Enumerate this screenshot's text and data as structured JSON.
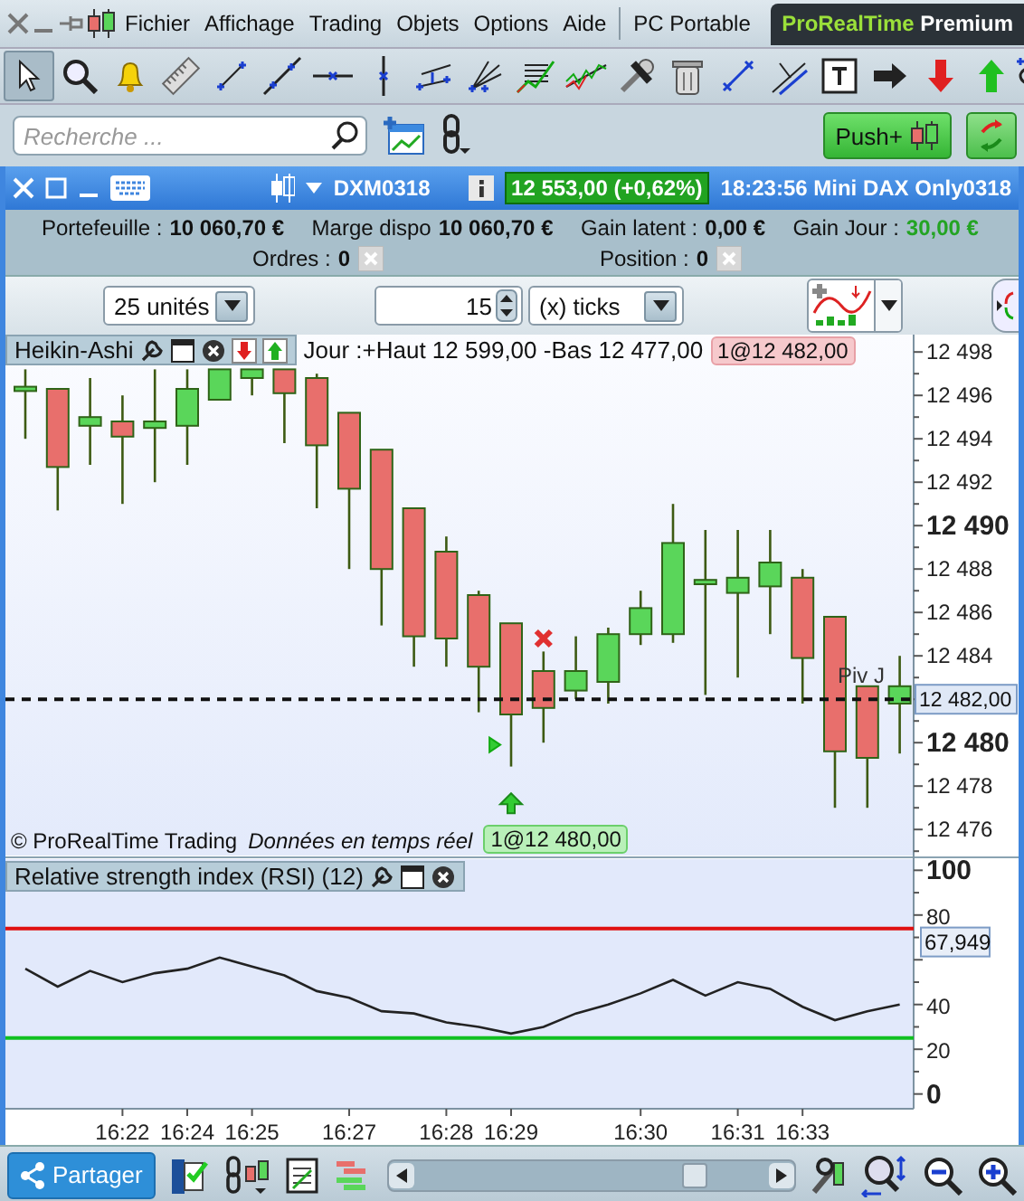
{
  "menubar": {
    "items": [
      {
        "label": "Fichier"
      },
      {
        "label": "Affichage"
      },
      {
        "label": "Trading"
      },
      {
        "label": "Objets"
      },
      {
        "label": "Options"
      },
      {
        "label": "Aide"
      }
    ],
    "workspace": "PC Portable",
    "brand": {
      "name": "ProRealTime",
      "edition": "Premium"
    }
  },
  "toolbar": {
    "tools": [
      {
        "selected": true
      },
      {
        "selected": false
      },
      {
        "selected": false
      },
      {
        "selected": false
      },
      {
        "selected": false
      },
      {
        "selected": false
      },
      {
        "selected": false
      },
      {
        "selected": false
      },
      {
        "selected": false
      },
      {
        "selected": false
      },
      {
        "selected": false
      },
      {
        "selected": false
      },
      {
        "selected": false
      },
      {
        "selected": false
      },
      {
        "selected": false
      },
      {
        "selected": false
      },
      {
        "selected": false
      },
      {
        "selected": false
      },
      {
        "selected": false
      },
      {
        "selected": false
      },
      {
        "selected": false
      }
    ]
  },
  "search": {
    "placeholder": "Recherche ..."
  },
  "push_button": {
    "label": "Push+"
  },
  "instrument_bar": {
    "symbol": "DXM0318",
    "quote": "12 553,00 (+0,62%)",
    "caption": "18:23:56 Mini DAX Only0318"
  },
  "account": {
    "fields": [
      {
        "label": "Portefeuille :",
        "value": "10 060,70 €",
        "kind": "plain"
      },
      {
        "label": "Marge dispo",
        "value": "10 060,70 €",
        "kind": "plain"
      },
      {
        "label": "Gain latent :",
        "value": "0,00 €",
        "kind": "plain"
      },
      {
        "label": "Gain Jour :",
        "value": "30,00 €",
        "kind": "gain"
      }
    ],
    "counters": [
      {
        "label": "Ordres :",
        "value": "0"
      },
      {
        "label": "Position :",
        "value": "0"
      }
    ]
  },
  "order_bar": {
    "quantity": "25 unités",
    "distance": "15",
    "unit": "(x) ticks"
  },
  "price_chart": {
    "day_info": "Jour :+Haut 12 599,00 -Bas 12 477,00",
    "order_tag": "1@12 482,00",
    "copyright": "© ProRealTime Trading",
    "feed": "Données en temps réel",
    "position_tag": "1@12 480,00",
    "chart_data": {
      "type": "candlestick",
      "title": "Heikin-Ashi",
      "ylim": [
        12474.8,
        12498.8
      ],
      "yticks": [
        {
          "value": 12498,
          "label": "12 498"
        },
        {
          "value": 12496,
          "label": "12 496"
        },
        {
          "value": 12494,
          "label": "12 494"
        },
        {
          "value": 12492,
          "label": "12 492"
        },
        {
          "value": 12490,
          "label": "12 490"
        },
        {
          "value": 12488,
          "label": "12 488"
        },
        {
          "value": 12486,
          "label": "12 486"
        },
        {
          "value": 12484,
          "label": "12 484"
        },
        {
          "value": 12480,
          "label": "12 480"
        },
        {
          "value": 12478,
          "label": "12 478"
        },
        {
          "value": 12476,
          "label": "12 476"
        }
      ],
      "ohlc": [
        [
          12496.2,
          12497.2,
          12494,
          12496.4
        ],
        [
          12496.3,
          12496.3,
          12490.7,
          12492.7
        ],
        [
          12494.6,
          12496.8,
          12492.8,
          12495
        ],
        [
          12494.8,
          12496,
          12491,
          12494.1
        ],
        [
          12494.5,
          12497.2,
          12492,
          12494.8
        ],
        [
          12494.6,
          12497.2,
          12492.8,
          12496.3
        ],
        [
          12495.8,
          12497.2,
          12495.8,
          12497.2
        ],
        [
          12496.8,
          12497.2,
          12496,
          12497.2
        ],
        [
          12497.2,
          12497.2,
          12493.8,
          12496.1
        ],
        [
          12496.8,
          12497,
          12490.8,
          12493.7
        ],
        [
          12495.2,
          12495.2,
          12488,
          12491.7
        ],
        [
          12493.5,
          12493.5,
          12485.4,
          12488
        ],
        [
          12490.8,
          12490.8,
          12483.5,
          12484.9
        ],
        [
          12488.8,
          12489.5,
          12483.5,
          12484.8
        ],
        [
          12486.8,
          12487,
          12481.4,
          12483.5
        ],
        [
          12485.5,
          12485.5,
          12478.9,
          12481.3
        ],
        [
          12483.3,
          12484.2,
          12480,
          12481.6
        ],
        [
          12482.4,
          12484.9,
          12482,
          12483.3
        ],
        [
          12482.8,
          12485.3,
          12481.8,
          12485
        ],
        [
          12485,
          12487,
          12484.5,
          12486.2
        ],
        [
          12485,
          12491,
          12484.6,
          12489.2
        ],
        [
          12487.3,
          12489.8,
          12482.2,
          12487.5
        ],
        [
          12486.9,
          12489.8,
          12483,
          12487.6
        ],
        [
          12487.2,
          12489.8,
          12485,
          12488.3
        ],
        [
          12487.6,
          12488,
          12481.8,
          12483.9
        ],
        [
          12485.8,
          12485.8,
          12477,
          12479.6
        ],
        [
          12482.6,
          12482.6,
          12477,
          12479.3
        ],
        [
          12481.8,
          12484,
          12479.5,
          12482.6
        ]
      ],
      "ref_lines": [
        {
          "axis": "y",
          "value": 12482,
          "label": "12 482,00"
        }
      ],
      "annotations": [
        {
          "text": "Piv J"
        }
      ]
    }
  },
  "rsi_chart": {
    "chart_data": {
      "type": "line",
      "title": "Relative strength index (RSI) (12)",
      "ylim": [
        -6.6,
        106.6
      ],
      "yticks": [
        {
          "value": 100,
          "label": "100"
        },
        {
          "value": 80,
          "label": "80"
        },
        {
          "value": 40,
          "label": "40"
        },
        {
          "value": 20,
          "label": "20"
        },
        {
          "value": 0,
          "label": "0"
        }
      ],
      "categories": [
        null,
        null,
        null,
        "16:22",
        null,
        "16:24",
        null,
        "16:25",
        null,
        null,
        "16:27",
        null,
        null,
        "16:28",
        null,
        "16:29",
        null,
        null,
        null,
        "16:30",
        null,
        null,
        "16:31",
        null,
        "16:33",
        null,
        null,
        null
      ],
      "series": [
        {
          "color": "#222222",
          "values": [
            56,
            48,
            55,
            50,
            54,
            56,
            61,
            57,
            53,
            46,
            43,
            37,
            36,
            32,
            30,
            27,
            30,
            36,
            40,
            45,
            51,
            44,
            50,
            47,
            39,
            33,
            37,
            40
          ]
        }
      ],
      "ref_lines": [
        {
          "axis": "y",
          "value": 74,
          "color": "#e01010"
        },
        {
          "axis": "y",
          "value": 25,
          "color": "#10c020"
        }
      ],
      "annotations": [
        {
          "text": "67,949"
        }
      ]
    }
  },
  "bottom_bar": {
    "share_button": "Partager"
  }
}
